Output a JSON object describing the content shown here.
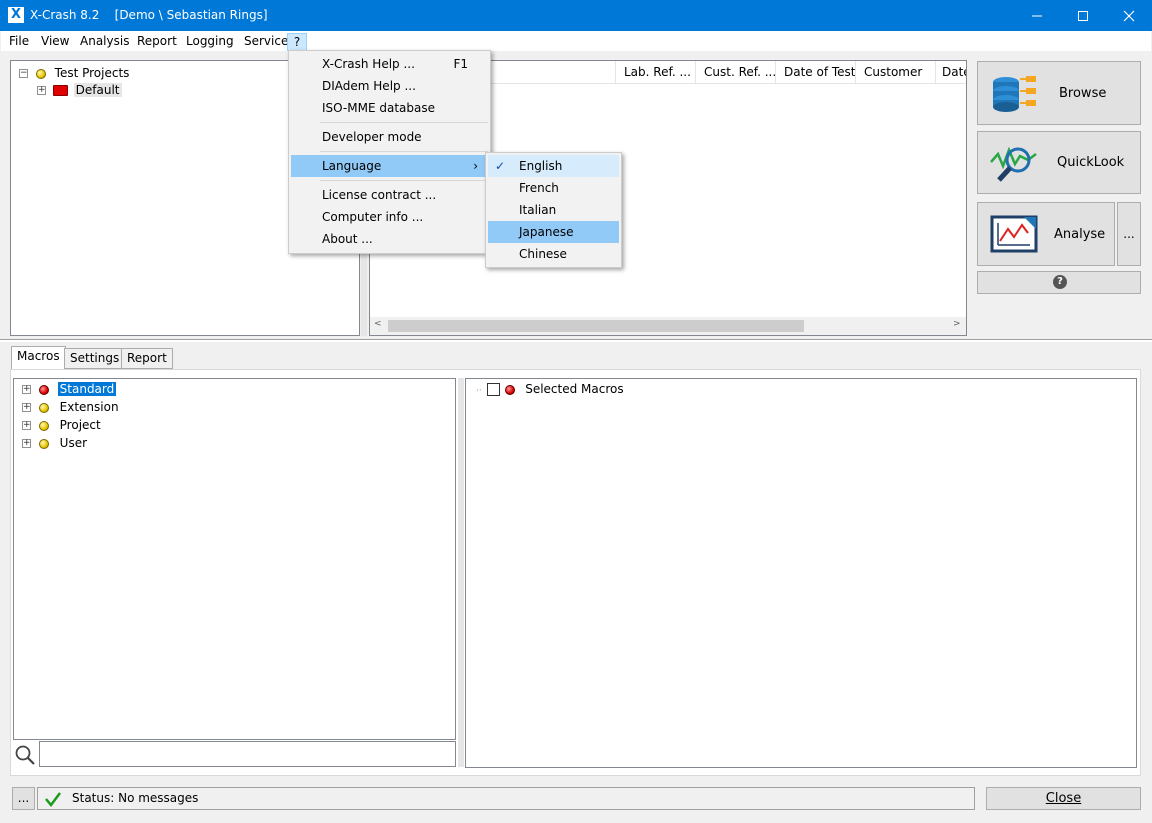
{
  "window": {
    "app_icon": "X",
    "title": "X-Crash 8.2    [Demo \\ Sebastian Rings]",
    "minimize_icon": "minimize-icon",
    "maximize_icon": "maximize-icon",
    "close_icon": "close-icon"
  },
  "menubar": [
    "File",
    "View",
    "Analysis",
    "Report",
    "Logging",
    "Service",
    "?"
  ],
  "project_tree": {
    "root": "Test Projects",
    "children": [
      "Default"
    ]
  },
  "table": {
    "columns": [
      "Lab. Ref. ...",
      "Cust. Ref. ...",
      "Date of Test",
      "Customer",
      "Date"
    ],
    "rows": []
  },
  "side_buttons": {
    "browse": "Browse",
    "quicklook": "QuickLook",
    "analyse": "Analyse",
    "more": "...",
    "help_icon": "?"
  },
  "tabs": [
    "Macros",
    "Settings",
    "Report"
  ],
  "macro_tree": [
    "Standard",
    "Extension",
    "Project",
    "User"
  ],
  "selected_macros": {
    "label": "Selected Macros",
    "checked": false
  },
  "search": {
    "value": "",
    "placeholder": ""
  },
  "status": {
    "more_button": "...",
    "text": "Status: No messages",
    "close_button": "Close"
  },
  "help_menu": {
    "items": [
      {
        "label": "X-Crash Help ...",
        "shortcut": "F1"
      },
      {
        "label": "DIAdem Help ..."
      },
      {
        "label": "ISO-MME database"
      },
      {
        "label": "Developer mode"
      },
      {
        "label": "Language",
        "submenu_arrow": "›"
      },
      {
        "label": "License contract ..."
      },
      {
        "label": "Computer info ..."
      },
      {
        "label": "About ..."
      }
    ]
  },
  "language_menu": {
    "items": [
      "English",
      "French",
      "Italian",
      "Japanese",
      "Chinese"
    ],
    "checked": "English",
    "highlighted": "Japanese",
    "check_mark": "✓"
  },
  "colors": {
    "titlebar": "#0078d7",
    "menu_highlight": "#91c9f7",
    "selection": "#0078d7"
  }
}
